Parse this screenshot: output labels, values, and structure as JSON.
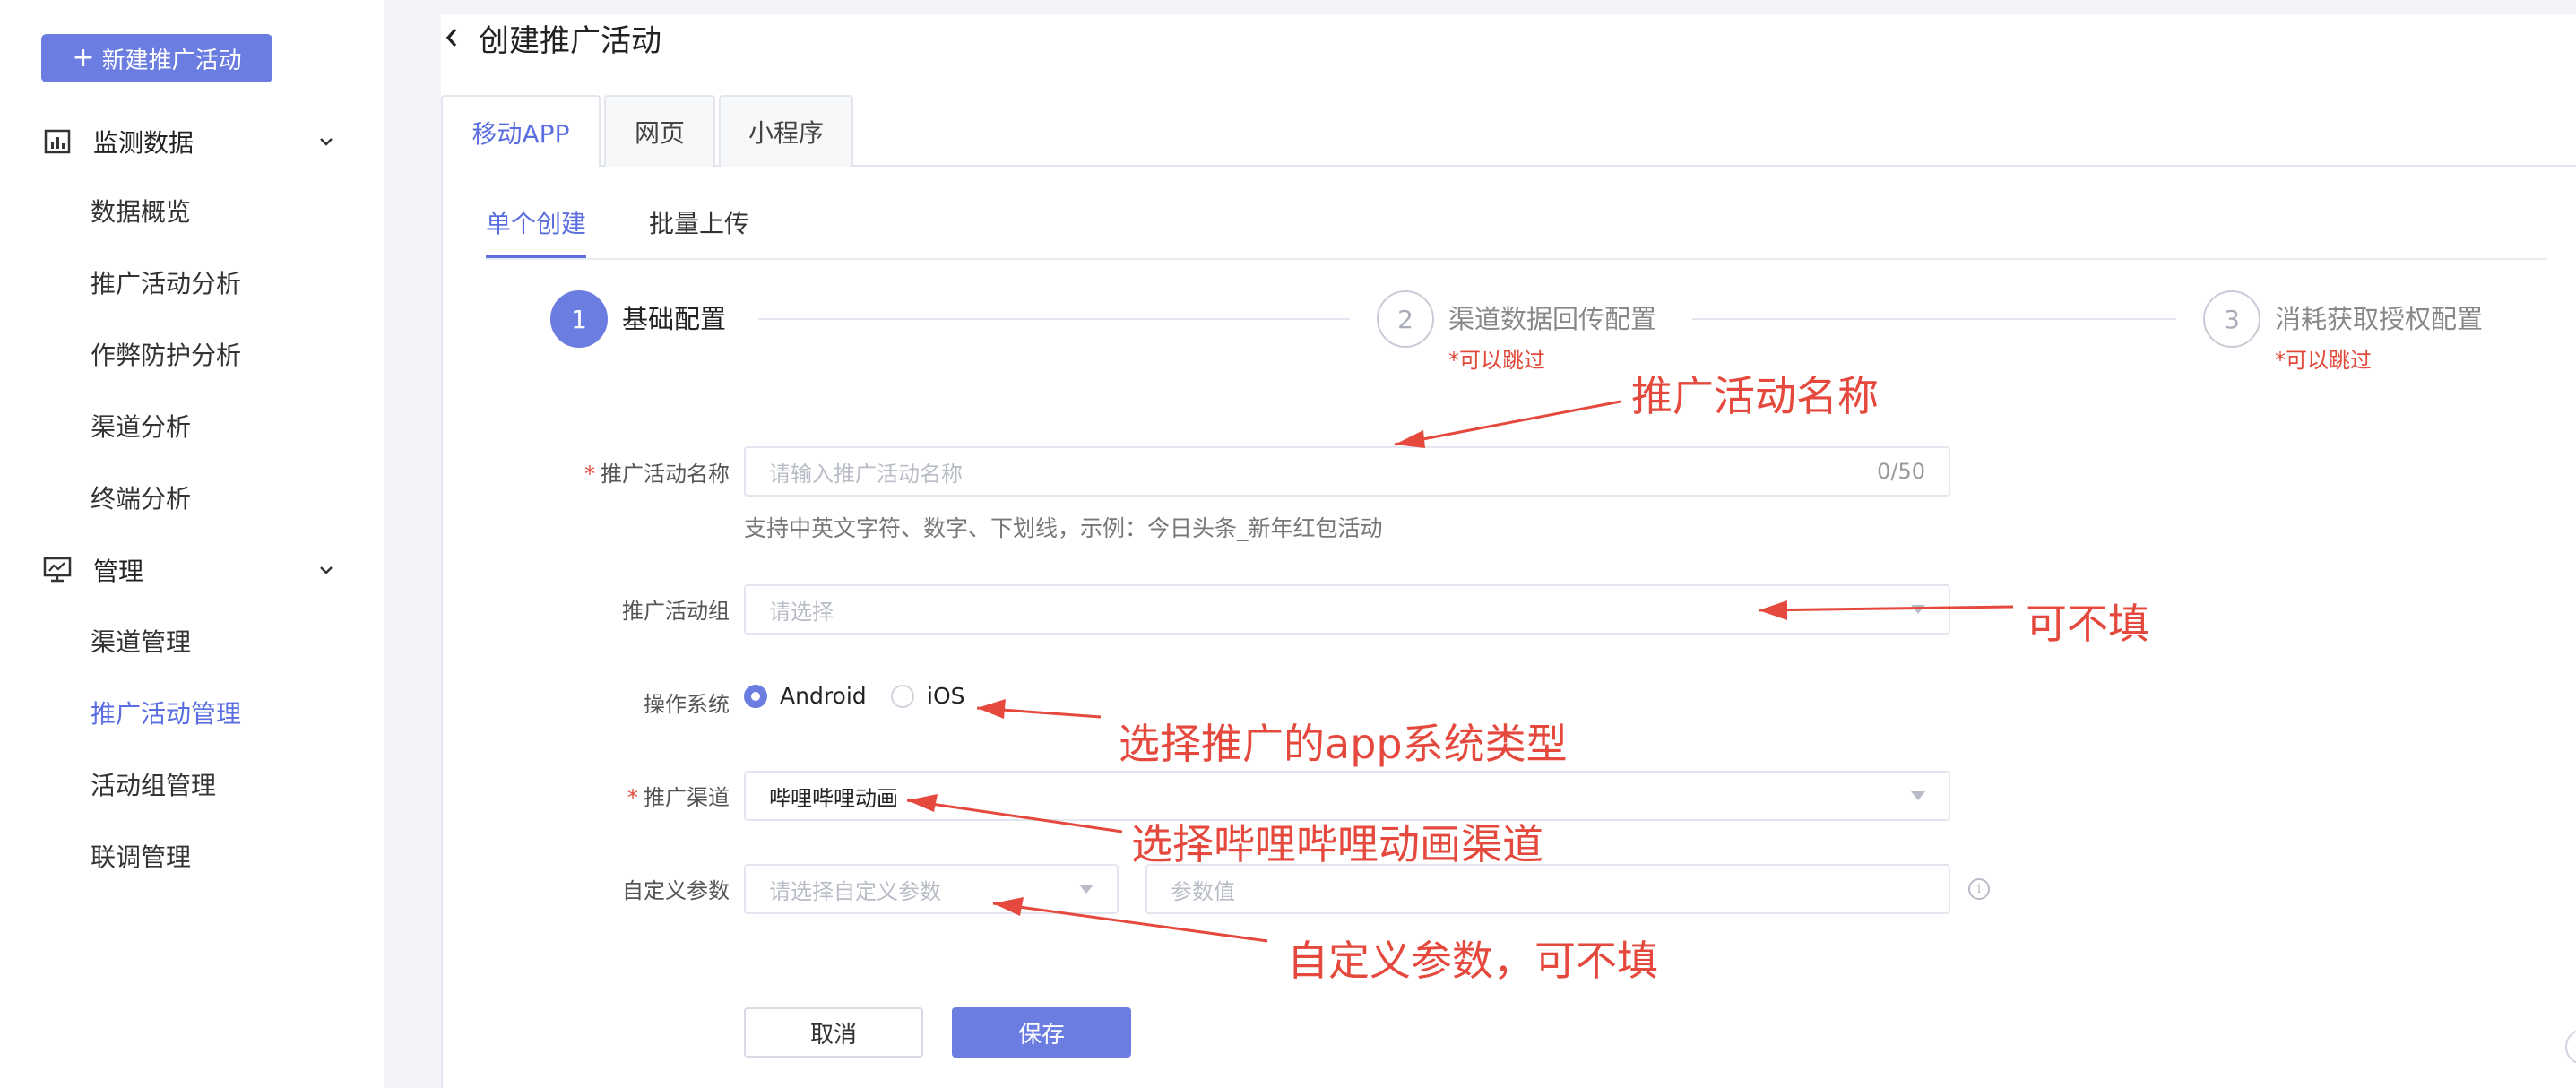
{
  "sidebar": {
    "new_button": "新建推广活动",
    "groups": [
      {
        "label": "监测数据",
        "icon": "bar-chart-icon",
        "items": [
          "数据概览",
          "推广活动分析",
          "作弊防护分析",
          "渠道分析",
          "终端分析"
        ]
      },
      {
        "label": "管理",
        "icon": "monitor-chart-icon",
        "items": [
          "渠道管理",
          "推广活动管理",
          "活动组管理",
          "联调管理"
        ]
      }
    ],
    "active_item": "推广活动管理"
  },
  "header": {
    "title": "创建推广活动"
  },
  "tabs": [
    {
      "label": "移动APP",
      "active": true
    },
    {
      "label": "网页",
      "active": false
    },
    {
      "label": "小程序",
      "active": false
    }
  ],
  "subtabs": [
    {
      "label": "单个创建",
      "active": true
    },
    {
      "label": "批量上传",
      "active": false
    }
  ],
  "steps": [
    {
      "num": "1",
      "title": "基础配置",
      "sub": "",
      "active": true
    },
    {
      "num": "2",
      "title": "渠道数据回传配置",
      "sub": "*可以跳过",
      "active": false
    },
    {
      "num": "3",
      "title": "消耗获取授权配置",
      "sub": "*可以跳过",
      "active": false
    }
  ],
  "form": {
    "name": {
      "label": "推广活动名称",
      "required": true,
      "placeholder": "请输入推广活动名称",
      "count": "0/50",
      "hint": "支持中英文字符、数字、下划线，示例：今日头条_新年红包活动"
    },
    "group": {
      "label": "推广活动组",
      "placeholder": "请选择"
    },
    "os": {
      "label": "操作系统",
      "options": [
        "Android",
        "iOS"
      ],
      "selected": "Android"
    },
    "channel": {
      "label": "推广渠道",
      "required": true,
      "value": "哔哩哔哩动画"
    },
    "custom": {
      "label": "自定义参数",
      "select_placeholder": "请选择自定义参数",
      "value_placeholder": "参数值"
    },
    "cancel_label": "取消",
    "save_label": "保存"
  },
  "annotations": [
    "推广活动名称",
    "可不填",
    "选择推广的app系统类型",
    "选择哔哩哔哩动画渠道",
    "自定义参数，可不填"
  ],
  "colors": {
    "accent": "#6b7de0",
    "annotation": "#e5483c",
    "required": "#e04a3b"
  }
}
